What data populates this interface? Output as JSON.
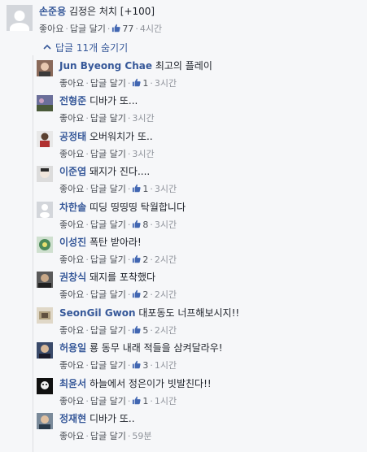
{
  "top_comment": {
    "author": "손준용",
    "text": "김정은 처치 [+100]",
    "actions": {
      "like": "좋아요",
      "reply": "답글 달기"
    },
    "likes": "77",
    "time": "4시간"
  },
  "toggle_label": "답글 11개 숨기기",
  "replies": [
    {
      "author": "Jun Byeong Chae",
      "text": "최고의 플레이",
      "likes": "1",
      "time": "3시간"
    },
    {
      "author": "전형준",
      "text": "디바가 또...",
      "likes": "",
      "time": "3시간"
    },
    {
      "author": "공정태",
      "text": "오버워치가 또..",
      "likes": "",
      "time": "3시간"
    },
    {
      "author": "이준엽",
      "text": "돼지가 진다....",
      "likes": "1",
      "time": "3시간"
    },
    {
      "author": "차한솔",
      "text": "띠딩 띵띵띵 탁월합니다",
      "likes": "8",
      "time": "3시간"
    },
    {
      "author": "이성진",
      "text": "폭탄 받아라!",
      "likes": "2",
      "time": "2시간"
    },
    {
      "author": "권창식",
      "text": "돼지를 포착했다",
      "likes": "2",
      "time": "2시간"
    },
    {
      "author": "SeonGil Gwon",
      "text": "대포동도 너프해보시지!!",
      "likes": "5",
      "time": "2시간"
    },
    {
      "author": "허용일",
      "text": "룡 동무 내래 적들을 삼켜달라우!",
      "likes": "3",
      "time": "1시간"
    },
    {
      "author": "최윤서",
      "text": "하늘에서 정은이가 빗발친다!!",
      "likes": "1",
      "time": "1시간"
    },
    {
      "author": "정재현",
      "text": "디바가 또..",
      "likes": "",
      "time": "59분"
    }
  ],
  "reply_actions": {
    "like": "좋아요",
    "reply": "답글 달기"
  },
  "colors": {
    "link": "#365899",
    "meta": "#90949c",
    "background": "#f6f7f9"
  },
  "icons": {
    "like": "thumbs-up-icon",
    "toggle": "chevron-up-icon"
  }
}
